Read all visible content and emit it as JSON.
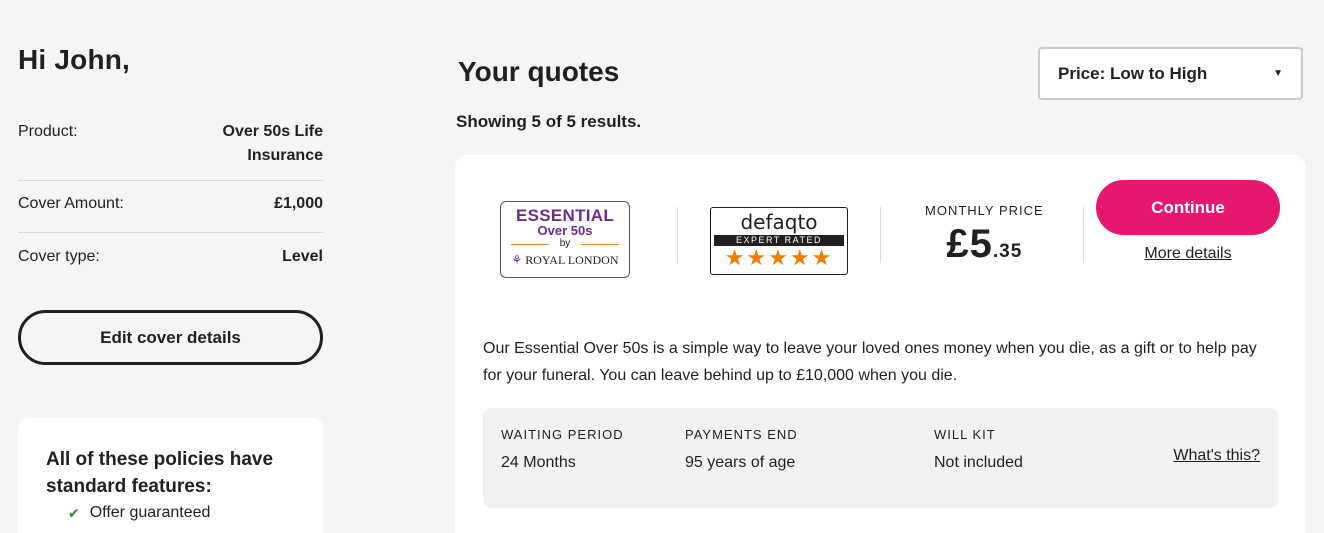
{
  "sidebar": {
    "greeting": "Hi John,",
    "summary": [
      {
        "label": "Product:",
        "value": "Over 50s Life Insurance"
      },
      {
        "label": "Cover Amount:",
        "value": "£1,000"
      },
      {
        "label": "Cover type:",
        "value": "Level"
      }
    ],
    "edit_button": "Edit cover details",
    "features": {
      "title": "All of these policies have standard features:",
      "items": [
        "Offer guaranteed"
      ]
    }
  },
  "main": {
    "title": "Your quotes",
    "results": "Showing 5 of 5 results.",
    "sort": {
      "selected": "Price: Low to High"
    },
    "quote": {
      "brand_logo": {
        "line1": "ESSENTIAL",
        "line2": "Over 50s",
        "line3": "by",
        "line4": "ROYAL LONDON"
      },
      "rating": {
        "brand": "defaqto",
        "label": "EXPERT RATED",
        "stars": "★★★★★",
        "stars_value": 5
      },
      "price_label": "MONTHLY PRICE",
      "price_pounds": "£5",
      "price_pence": ".35",
      "continue_label": "Continue",
      "more_details": "More details",
      "description": "Our Essential Over 50s is a simple way to leave your loved ones money when you die, as a gift or to help pay for your funeral. You can leave behind up to £10,000 when you die.",
      "features": [
        {
          "label": "WAITING PERIOD",
          "value": "24 Months"
        },
        {
          "label": "PAYMENTS END",
          "value": "95 years of age"
        },
        {
          "label": "WILL KIT",
          "value": "Not included"
        }
      ],
      "whats_this": "What's this?"
    }
  },
  "colors": {
    "accent": "#e5176f",
    "brand_purple": "#6b2c91",
    "star_orange": "#f07c00",
    "check_green": "#2e8540"
  }
}
